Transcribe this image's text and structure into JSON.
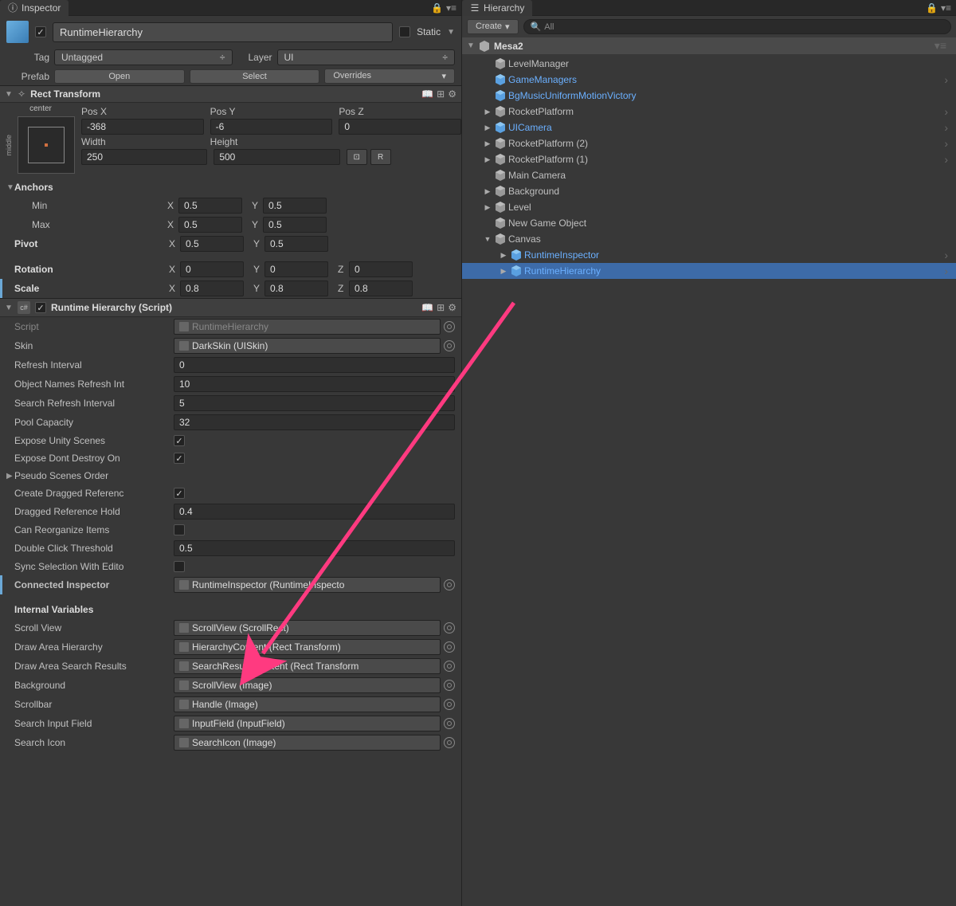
{
  "inspector": {
    "tab_label": "Inspector",
    "object_name": "RuntimeHierarchy",
    "static_label": "Static",
    "tag_label": "Tag",
    "tag_value": "Untagged",
    "layer_label": "Layer",
    "layer_value": "UI",
    "prefab_label": "Prefab",
    "prefab_open": "Open",
    "prefab_select": "Select",
    "prefab_overrides": "Overrides"
  },
  "rect_transform": {
    "title": "Rect Transform",
    "anchor_h": "center",
    "anchor_v": "middle",
    "pos_x_label": "Pos X",
    "pos_y_label": "Pos Y",
    "pos_z_label": "Pos Z",
    "pos_x": "-368",
    "pos_y": "-6",
    "pos_z": "0",
    "width_label": "Width",
    "height_label": "Height",
    "width": "250",
    "height": "500",
    "blueprint_btn": "⬜",
    "raw_btn": "R",
    "anchors_label": "Anchors",
    "min_label": "Min",
    "max_label": "Max",
    "min_x": "0.5",
    "min_y": "0.5",
    "max_x": "0.5",
    "max_y": "0.5",
    "pivot_label": "Pivot",
    "pivot_x": "0.5",
    "pivot_y": "0.5",
    "rotation_label": "Rotation",
    "rot_x": "0",
    "rot_y": "0",
    "rot_z": "0",
    "scale_label": "Scale",
    "scale_x": "0.8",
    "scale_y": "0.8",
    "scale_z": "0.8"
  },
  "runtime_hierarchy": {
    "title": "Runtime Hierarchy (Script)",
    "script_label": "Script",
    "script_value": "RuntimeHierarchy",
    "skin_label": "Skin",
    "skin_value": "DarkSkin (UISkin)",
    "refresh_label": "Refresh Interval",
    "refresh_value": "0",
    "obj_names_label": "Object Names Refresh Int",
    "obj_names_value": "10",
    "search_refresh_label": "Search Refresh Interval",
    "search_refresh_value": "5",
    "pool_label": "Pool Capacity",
    "pool_value": "32",
    "expose_scenes_label": "Expose Unity Scenes",
    "expose_dont_destroy_label": "Expose Dont Destroy On",
    "pseudo_scenes_label": "Pseudo Scenes Order",
    "create_dragged_label": "Create Dragged Referenc",
    "dragged_hold_label": "Dragged Reference Hold",
    "dragged_hold_value": "0.4",
    "can_reorganize_label": "Can Reorganize Items",
    "double_click_label": "Double Click Threshold",
    "double_click_value": "0.5",
    "sync_selection_label": "Sync Selection With Edito",
    "connected_inspector_label": "Connected Inspector",
    "connected_inspector_value": "RuntimeInspector (RuntimeInspecto",
    "internal_vars_label": "Internal Variables",
    "scroll_view_label": "Scroll View",
    "scroll_view_value": "ScrollView (ScrollRect)",
    "draw_area_h_label": "Draw Area Hierarchy",
    "draw_area_h_value": "HierarchyContent (Rect Transform)",
    "draw_area_s_label": "Draw Area Search Results",
    "draw_area_s_value": "SearchResultsContent (Rect Transform",
    "background_label": "Background",
    "background_value": "ScrollView (Image)",
    "scrollbar_label": "Scrollbar",
    "scrollbar_value": "Handle (Image)",
    "search_input_label": "Search Input Field",
    "search_input_value": "InputField (InputField)",
    "search_icon_label": "Search Icon",
    "search_icon_value": "SearchIcon (Image)"
  },
  "hierarchy": {
    "tab_label": "Hierarchy",
    "create_label": "Create",
    "search_placeholder": "All",
    "scene_name": "Mesa2",
    "items": [
      {
        "label": "LevelManager",
        "indent": 1,
        "blue": false,
        "foldout": "",
        "chevron": false
      },
      {
        "label": "GameManagers",
        "indent": 1,
        "blue": true,
        "foldout": "",
        "chevron": true
      },
      {
        "label": "BgMusicUniformMotionVictory",
        "indent": 1,
        "blue": true,
        "foldout": "",
        "chevron": false
      },
      {
        "label": "RocketPlatform",
        "indent": 1,
        "blue": false,
        "foldout": "▶",
        "chevron": true
      },
      {
        "label": "UICamera",
        "indent": 1,
        "blue": true,
        "foldout": "▶",
        "chevron": true
      },
      {
        "label": "RocketPlatform (2)",
        "indent": 1,
        "blue": false,
        "foldout": "▶",
        "chevron": true
      },
      {
        "label": "RocketPlatform (1)",
        "indent": 1,
        "blue": false,
        "foldout": "▶",
        "chevron": true
      },
      {
        "label": "Main Camera",
        "indent": 1,
        "blue": false,
        "foldout": "",
        "chevron": false
      },
      {
        "label": "Background",
        "indent": 1,
        "blue": false,
        "foldout": "▶",
        "chevron": false
      },
      {
        "label": "Level",
        "indent": 1,
        "blue": false,
        "foldout": "▶",
        "chevron": false
      },
      {
        "label": "New Game Object",
        "indent": 1,
        "blue": false,
        "foldout": "",
        "chevron": false
      },
      {
        "label": "Canvas",
        "indent": 1,
        "blue": false,
        "foldout": "▼",
        "chevron": false
      },
      {
        "label": "RuntimeInspector",
        "indent": 2,
        "blue": true,
        "foldout": "▶",
        "chevron": true
      },
      {
        "label": "RuntimeHierarchy",
        "indent": 2,
        "blue": true,
        "foldout": "▶",
        "chevron": true,
        "selected": true
      }
    ]
  }
}
